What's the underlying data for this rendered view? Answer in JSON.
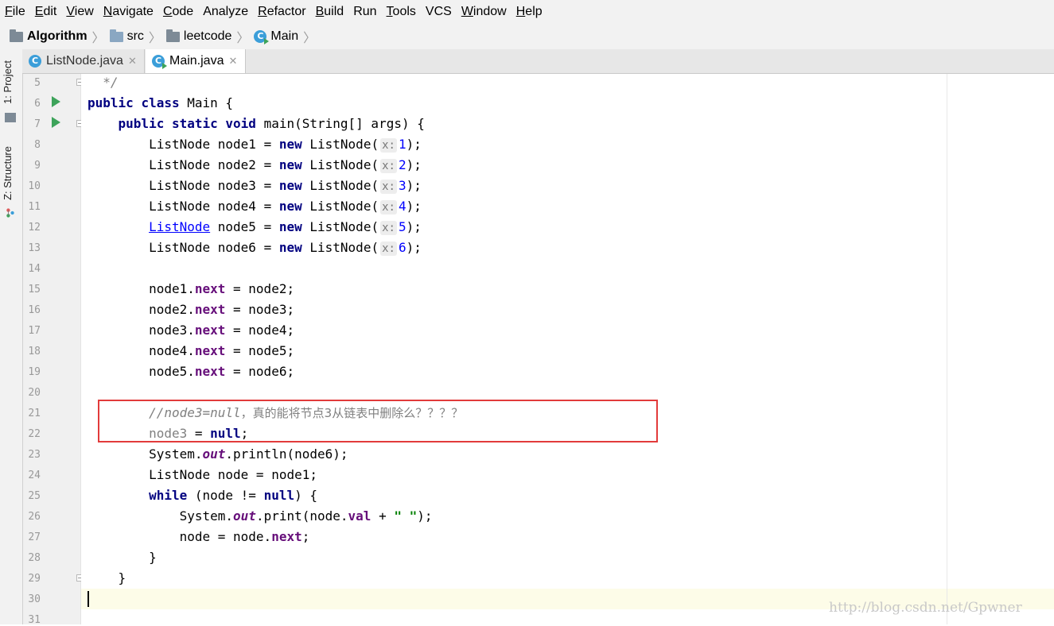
{
  "menu": [
    {
      "label": "File",
      "mnemonic": "F",
      "rest": "ile"
    },
    {
      "label": "Edit",
      "mnemonic": "E",
      "rest": "dit"
    },
    {
      "label": "View",
      "mnemonic": "V",
      "rest": "iew"
    },
    {
      "label": "Navigate",
      "mnemonic": "N",
      "rest": "avigate"
    },
    {
      "label": "Code",
      "mnemonic": "C",
      "rest": "ode"
    },
    {
      "label": "Analyze",
      "mnemonic": "",
      "rest": "Analyze"
    },
    {
      "label": "Refactor",
      "mnemonic": "R",
      "rest": "efactor"
    },
    {
      "label": "Build",
      "mnemonic": "B",
      "rest": "uild"
    },
    {
      "label": "Run",
      "mnemonic": "",
      "rest": "Run"
    },
    {
      "label": "Tools",
      "mnemonic": "T",
      "rest": "ools"
    },
    {
      "label": "VCS",
      "mnemonic": "",
      "rest": "VCS"
    },
    {
      "label": "Window",
      "mnemonic": "W",
      "rest": "indow"
    },
    {
      "label": "Help",
      "mnemonic": "H",
      "rest": "elp"
    }
  ],
  "breadcrumb": [
    "Algorithm",
    "src",
    "leetcode",
    "Main"
  ],
  "tabs": [
    {
      "label": "ListNode.java",
      "icon": "java-class-icon",
      "active": false
    },
    {
      "label": "Main.java",
      "icon": "java-class-icon",
      "active": true
    }
  ],
  "tool_windows": [
    "1: Project",
    "Z: Structure"
  ],
  "gutter": {
    "line_numbers": [
      "5",
      "6",
      "7",
      "8",
      "9",
      "10",
      "11",
      "12",
      "13",
      "14",
      "15",
      "16",
      "17",
      "18",
      "19",
      "20",
      "21",
      "22",
      "23",
      "24",
      "25",
      "26",
      "27",
      "28",
      "29",
      "30",
      "31"
    ],
    "run_markers_on_lines": [
      "6",
      "7"
    ]
  },
  "code": {
    "l5": "*/",
    "l8": {
      "type": "ListNode",
      "var": "node1",
      "hint": "x:",
      "arg": "1"
    },
    "l9": {
      "type": "ListNode",
      "var": "node2",
      "hint": "x:",
      "arg": "2"
    },
    "l10": {
      "type": "ListNode",
      "var": "node3",
      "hint": "x:",
      "arg": "3"
    },
    "l11": {
      "type": "ListNode",
      "var": "node4",
      "hint": "x:",
      "arg": "4"
    },
    "l12": {
      "type": "ListNode",
      "var": "node5",
      "hint": "x:",
      "arg": "5"
    },
    "l13": {
      "type": "ListNode",
      "var": "node6",
      "hint": "x:",
      "arg": "6"
    },
    "l21_comment_code": "//node3=null",
    "l21_comment_text": "，真的能将节点3从链表中删除么？？？？",
    "kw_public": "public",
    "kw_class": "class",
    "kw_static": "static",
    "kw_void": "void",
    "kw_new": "new",
    "kw_null": "null",
    "kw_while": "while",
    "field_next": "next",
    "field_val": "val",
    "field_out": "out",
    "string_space": "\" \""
  },
  "watermark": "http://blog.csdn.net/Gpwner",
  "colors": {
    "keyword": "#000080",
    "field": "#660e7a",
    "number": "#0000ff",
    "string": "#008000",
    "comment": "#808080",
    "highlight_box": "#e23b3b",
    "caret_line": "#fdfce8"
  }
}
